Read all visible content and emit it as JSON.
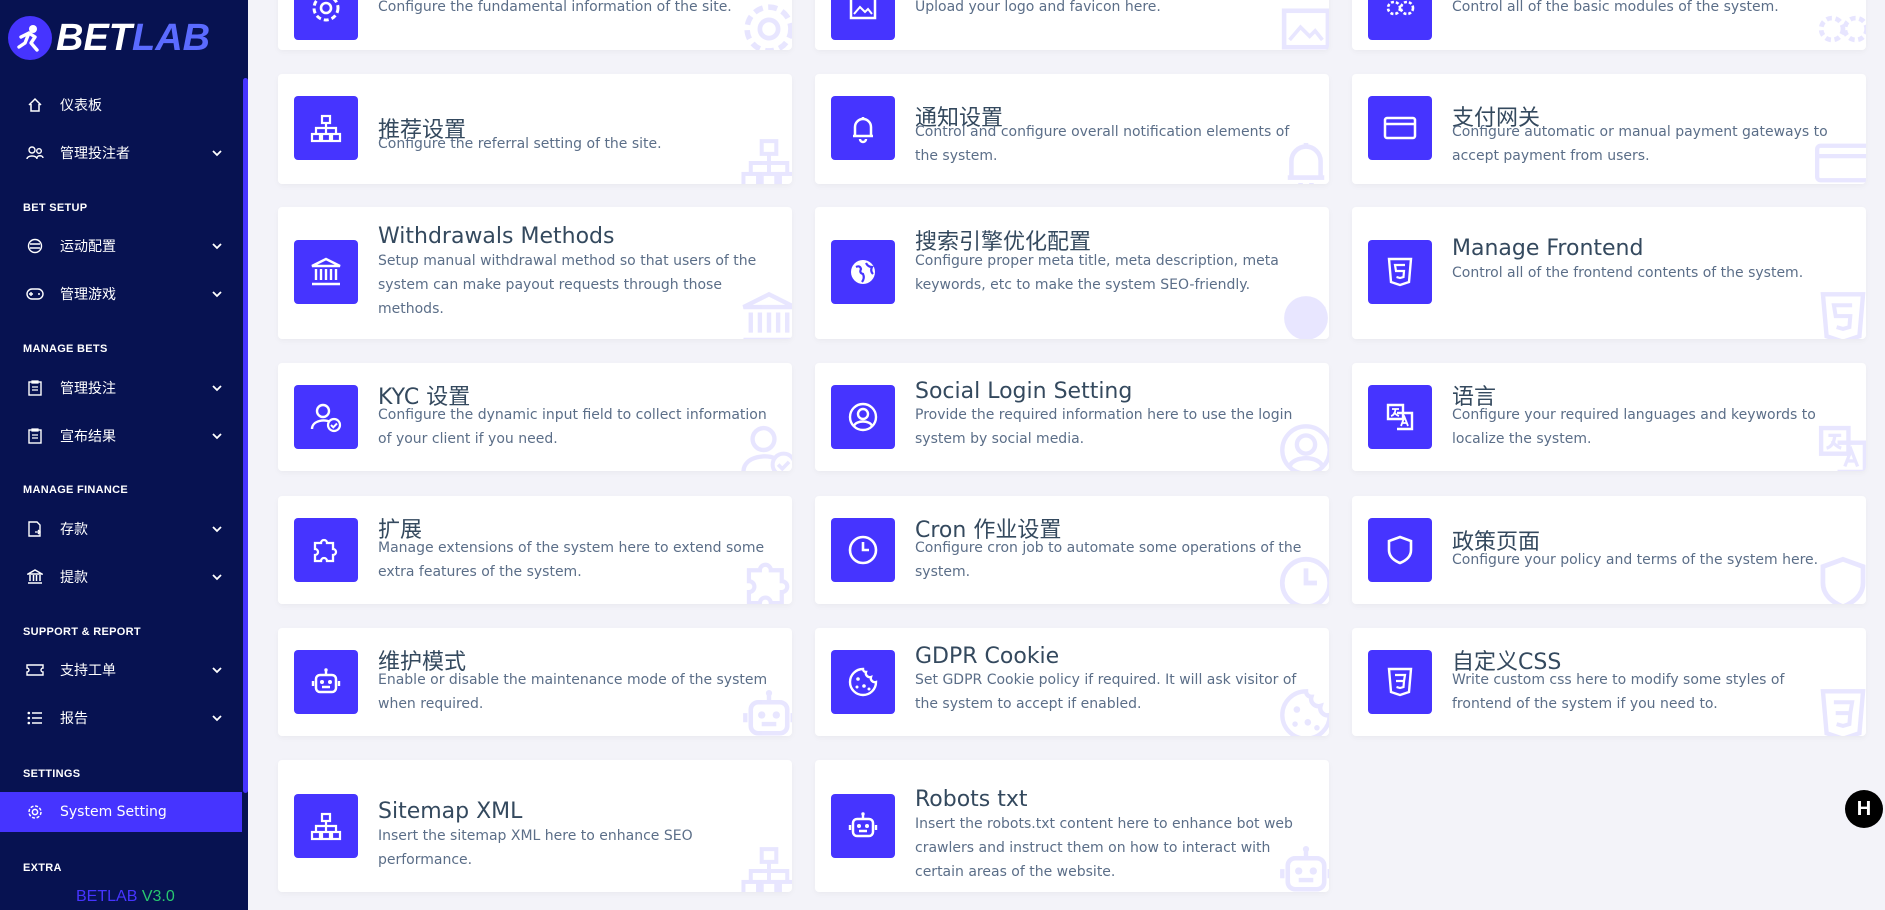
{
  "brand": {
    "name_a": "BET",
    "name_b": "LAB",
    "version_name": "BETLAB",
    "version_num": "V3.0"
  },
  "colors": {
    "sidebar_bg": "#071251",
    "accent": "#4634ff",
    "version_green": "#28c76f"
  },
  "sidebar": {
    "items": [
      {
        "label": "仪表板",
        "icon": "home-icon"
      },
      {
        "label": "管理投注者",
        "icon": "users-icon",
        "chevron": true
      },
      {
        "label": "运动配置",
        "icon": "sport-icon",
        "chevron": true
      },
      {
        "label": "管理游戏",
        "icon": "gamepad-icon",
        "chevron": true
      },
      {
        "label": "管理投注",
        "icon": "clipboard-icon",
        "chevron": true
      },
      {
        "label": "宣布结果",
        "icon": "clipboard-icon",
        "chevron": true
      },
      {
        "label": "存款",
        "icon": "deposit-icon",
        "chevron": true
      },
      {
        "label": "提款",
        "icon": "bank-icon",
        "chevron": true
      },
      {
        "label": "支持工单",
        "icon": "ticket-icon",
        "chevron": true
      },
      {
        "label": "报告",
        "icon": "list-icon",
        "chevron": true
      },
      {
        "label": "System Setting",
        "icon": "gear-icon",
        "active": true
      }
    ],
    "sections": [
      "BET SETUP",
      "MANAGE BETS",
      "MANAGE FINANCE",
      "SUPPORT & REPORT",
      "SETTINGS",
      "EXTRA"
    ]
  },
  "cards": [
    {
      "title": "",
      "desc": "Configure the fundamental information of the site.",
      "icon": "gear-icon"
    },
    {
      "title": "",
      "desc": "Upload your logo and favicon here.",
      "icon": "image-icon"
    },
    {
      "title": "",
      "desc": "Control all of the basic modules of the system.",
      "icon": "gears-icon"
    },
    {
      "title": "推荐设置",
      "desc": "Configure the referral setting of the site.",
      "icon": "sitemap-icon"
    },
    {
      "title": "通知设置",
      "desc": "Control and configure overall notification elements of the system.",
      "icon": "bell-icon"
    },
    {
      "title": "支付网关",
      "desc": "Configure automatic or manual payment gateways to accept payment from users.",
      "icon": "card-icon"
    },
    {
      "title": "Withdrawals Methods",
      "desc": "Setup manual withdrawal method so that users of the system can make payout requests through those methods.",
      "icon": "bank-icon"
    },
    {
      "title": "搜索引擎优化配置",
      "desc": "Configure proper meta title, meta description, meta keywords, etc to make the system SEO-friendly.",
      "icon": "globe-icon"
    },
    {
      "title": "Manage Frontend",
      "desc": "Control all of the frontend contents of the system.",
      "icon": "html5-icon"
    },
    {
      "title": "KYC 设置",
      "desc": "Configure the dynamic input field to collect information of your client if you need.",
      "icon": "user-check-icon"
    },
    {
      "title": "Social Login Setting",
      "desc": "Provide the required information here to use the login system by social media.",
      "icon": "user-circle-icon"
    },
    {
      "title": "语言",
      "desc": "Configure your required languages and keywords to localize the system.",
      "icon": "language-icon"
    },
    {
      "title": "扩展",
      "desc": "Manage extensions of the system here to extend some extra features of the system.",
      "icon": "puzzle-icon"
    },
    {
      "title": "Cron 作业设置",
      "desc": "Configure cron job to automate some operations of the system.",
      "icon": "clock-icon"
    },
    {
      "title": "政策页面",
      "desc": "Configure your policy and terms of the system here.",
      "icon": "shield-icon"
    },
    {
      "title": "维护模式",
      "desc": "Enable or disable the maintenance mode of the system when required.",
      "icon": "robot-icon"
    },
    {
      "title": "GDPR Cookie",
      "desc": "Set GDPR Cookie policy if required. It will ask visitor of the system to accept if enabled.",
      "icon": "cookie-icon"
    },
    {
      "title": "自定义CSS",
      "desc": "Write custom css here to modify some styles of frontend of the system if you need to.",
      "icon": "css3-icon"
    },
    {
      "title": "Sitemap XML",
      "desc": "Insert the sitemap XML here to enhance SEO performance.",
      "icon": "sitemap-icon"
    },
    {
      "title": "Robots txt",
      "desc": "Insert the robots.txt content here to enhance bot web crawlers and instruct them on how to interact with certain areas of the website.",
      "icon": "robot-icon"
    }
  ],
  "help_button": {
    "label": "H"
  }
}
